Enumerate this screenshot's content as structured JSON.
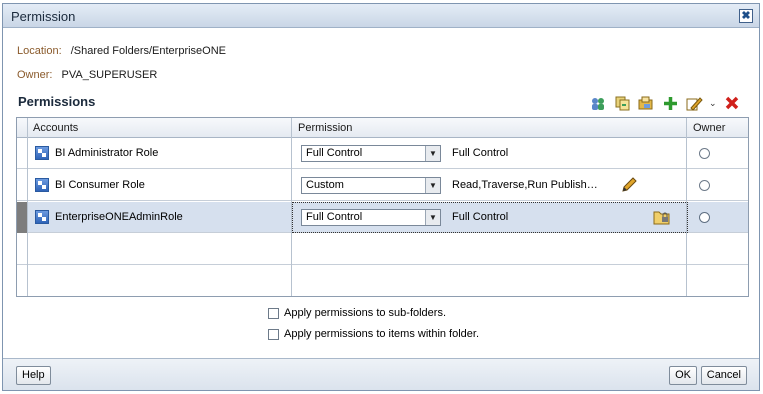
{
  "dialog": {
    "title": "Permission",
    "close_glyph": "✖"
  },
  "location": {
    "label": "Location:",
    "value": "/Shared Folders/EnterpriseONE"
  },
  "owner": {
    "label": "Owner:",
    "value": "PVA_SUPERUSER"
  },
  "permissions_section": {
    "title": "Permissions"
  },
  "toolbar": {
    "icons": [
      "add-users-icon",
      "copy-permissions-icon",
      "paste-permissions-icon",
      "add-icon",
      "edit-icon",
      "dropdown-chevron-icon",
      "delete-icon"
    ]
  },
  "table": {
    "headers": {
      "accounts": "Accounts",
      "permission": "Permission",
      "owner": "Owner"
    },
    "rows": [
      {
        "account": "BI Administrator Role",
        "permission_select": "Full Control",
        "permission_text": "Full Control",
        "selected": false
      },
      {
        "account": "BI Consumer Role",
        "permission_select": "Custom",
        "permission_text": "Read,Traverse,Run Publish…",
        "selected": false
      },
      {
        "account": "EnterpriseONEAdminRole",
        "permission_select": "Full Control",
        "permission_text": "Full Control",
        "selected": true
      }
    ]
  },
  "options": {
    "subfolders": "Apply permissions to sub-folders.",
    "items": "Apply permissions to items within folder."
  },
  "footer": {
    "help": "Help",
    "ok": "OK",
    "cancel": "Cancel"
  },
  "colors": {
    "accent": "#1b2a3c",
    "label_brown": "#8a5a2b",
    "selected_row": "#d6e0ee",
    "delete_red": "#d0201b",
    "add_green": "#2e9a2e"
  }
}
